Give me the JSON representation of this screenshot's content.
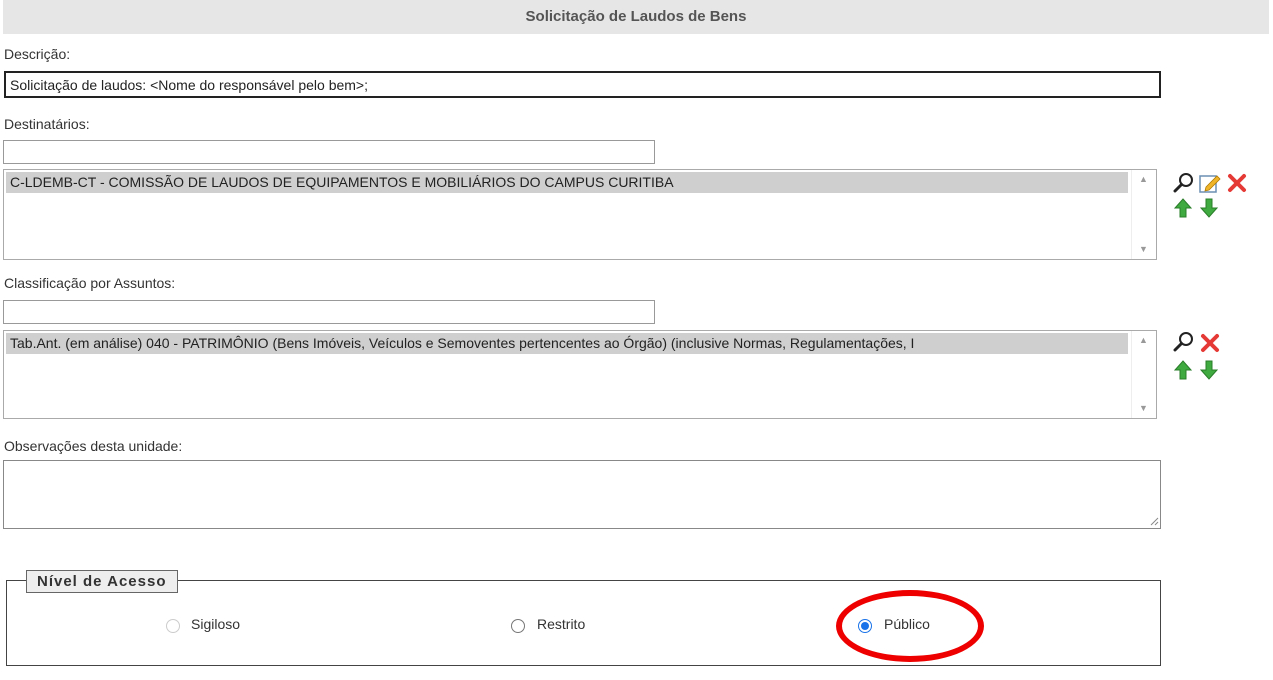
{
  "title": "Solicitação de Laudos de Bens",
  "descricao": {
    "label": "Descrição:",
    "value": "Solicitação de laudos: <Nome do responsável pelo bem>;"
  },
  "destinatarios": {
    "label": "Destinatários:",
    "search_value": "",
    "items": [
      "C-LDEMB-CT - COMISSÃO DE LAUDOS DE EQUIPAMENTOS E MOBILIÁRIOS DO CAMPUS CURITIBA"
    ]
  },
  "classificacao": {
    "label": "Classificação por Assuntos:",
    "search_value": "",
    "items": [
      "Tab.Ant. (em análise) 040 - PATRIMÔNIO (Bens Imóveis, Veículos e Semoventes pertencentes ao Órgão) (inclusive Normas, Regulamentações, I"
    ]
  },
  "observacoes": {
    "label": "Observações desta unidade:",
    "value": ""
  },
  "nivel_acesso": {
    "legend": "Nível de Acesso",
    "options": [
      {
        "label": "Sigiloso",
        "state": "disabled"
      },
      {
        "label": "Restrito",
        "state": "unchecked"
      },
      {
        "label": "Público",
        "state": "checked"
      }
    ]
  },
  "icons": {
    "search": "search-icon",
    "edit": "edit-icon",
    "remove": "remove-icon",
    "move_up": "arrow-up-icon",
    "move_down": "arrow-down-icon"
  },
  "colors": {
    "title_bg": "#e6e6e6",
    "radio_checked": "#1a73e8",
    "highlight": "#ee0000",
    "remove_icon": "#e53935",
    "arrow_icon": "#3faa3f"
  }
}
